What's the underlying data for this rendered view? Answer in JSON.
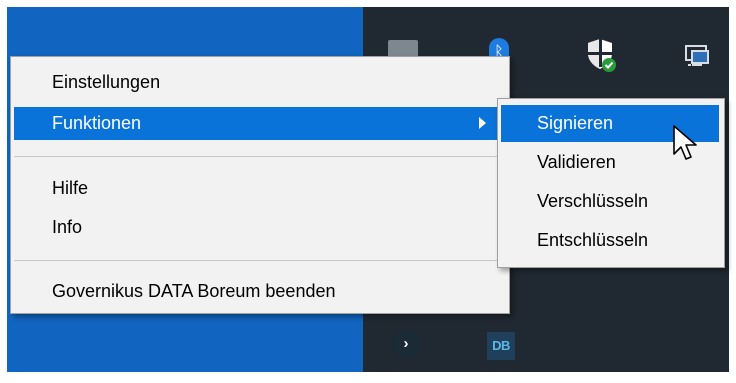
{
  "context_menu": {
    "items": [
      {
        "label": "Einstellungen"
      },
      {
        "label": "Funktionen",
        "active": true
      },
      {
        "label": "Hilfe"
      },
      {
        "label": "Info"
      },
      {
        "label": "Governikus DATA Boreum beenden"
      }
    ]
  },
  "submenu": {
    "items": [
      {
        "label": "Signieren",
        "active": true
      },
      {
        "label": "Validieren"
      },
      {
        "label": "Verschlüsseln"
      },
      {
        "label": "Entschlüsseln"
      }
    ]
  },
  "tray_icons": [
    {
      "icon": "network-icon"
    },
    {
      "icon": "bluetooth-icon"
    },
    {
      "icon": "security-shield-icon"
    },
    {
      "icon": "remote-desktop-icon"
    },
    {
      "icon": "arrow-app-icon"
    },
    {
      "icon": "data-boreum-icon",
      "text": "DB"
    }
  ],
  "colors": {
    "desktop_blue": "#1164c0",
    "tray_background": "#202831",
    "menu_background": "#f2f2f2",
    "highlight": "#0a73d9"
  }
}
